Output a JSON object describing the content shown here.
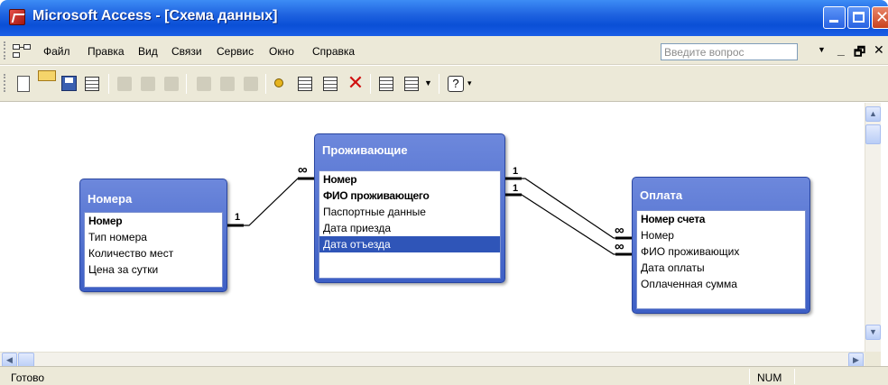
{
  "window": {
    "title": "Microsoft Access - [Схема данных]"
  },
  "menu": {
    "items": [
      "Файл",
      "Правка",
      "Вид",
      "Связи",
      "Сервис",
      "Окно",
      "Справка"
    ],
    "ask_placeholder": "Введите вопрос"
  },
  "toolbar": {
    "icons": [
      "new-icon",
      "open-icon",
      "save-icon",
      "properties-icon",
      "print-icon",
      "print-preview-icon",
      "spelling-icon",
      "cut-icon",
      "copy-icon",
      "paste-icon",
      "show-table-icon",
      "show-direct-icon",
      "show-all-icon",
      "delete-icon",
      "database-window-icon",
      "new-object-icon",
      "help-icon"
    ]
  },
  "tables": {
    "nomera": {
      "title": "Номера",
      "fields": [
        {
          "name": "Номер",
          "key": true
        },
        {
          "name": "Тип номера",
          "key": false
        },
        {
          "name": "Количество мест",
          "key": false
        },
        {
          "name": "Цена за сутки",
          "key": false
        }
      ]
    },
    "prozhivayushchie": {
      "title": "Проживающие",
      "fields": [
        {
          "name": "Номер",
          "key": true
        },
        {
          "name": "ФИО проживающего",
          "key": true
        },
        {
          "name": "Паспортные данные",
          "key": false
        },
        {
          "name": "Дата приезда",
          "key": false
        },
        {
          "name": "Дата отъезда",
          "key": false,
          "selected": true
        }
      ]
    },
    "oplata": {
      "title": "Оплата",
      "fields": [
        {
          "name": "Номер счета",
          "key": true
        },
        {
          "name": "Номер",
          "key": false
        },
        {
          "name": "ФИО проживающих",
          "key": false
        },
        {
          "name": "Дата оплаты",
          "key": false
        },
        {
          "name": "Оплаченная сумма",
          "key": false
        }
      ]
    }
  },
  "relationships": [
    {
      "from": "Номера",
      "to": "Проживающие",
      "one": "1",
      "many": "∞"
    },
    {
      "from": "Проживающие",
      "to": "Оплата",
      "one": "1",
      "many": "∞"
    },
    {
      "from": "Проживающие",
      "to": "Оплата",
      "one": "1",
      "many": "∞"
    }
  ],
  "status": {
    "text": "Готово",
    "num": "NUM"
  }
}
